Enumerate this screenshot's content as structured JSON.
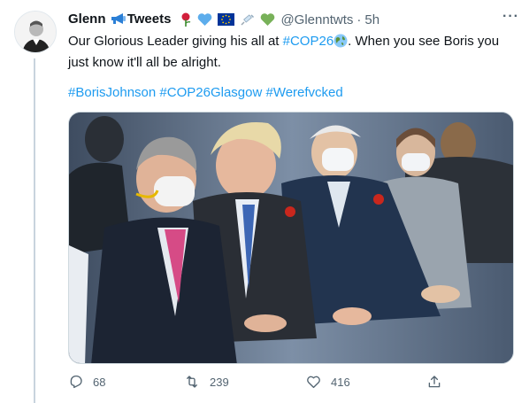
{
  "tweet": {
    "display_name": "Glenn",
    "display_name_suffix": "Tweets",
    "handle": "@Glenntwts",
    "separator": "·",
    "time": "5h",
    "more_label": "···",
    "text_before": "Our Glorious Leader giving his all at ",
    "cop_tag": "#COP26",
    "text_after": ". When you see Boris you just know it'll all be alright.",
    "hashtags": [
      "#BorisJohnson",
      "#COP26Glasgow",
      "#Werefvcked"
    ],
    "image_alt": "Photo of four men in suits and face masks seated at an event, a woman in a face mask behind them"
  },
  "actions": {
    "reply_count": "68",
    "retweet_count": "239",
    "like_count": "416"
  },
  "icons": {
    "megaphone": "megaphone-icon",
    "rose": "rose-icon",
    "heart_blue": "blue-heart-icon",
    "eu_flag": "eu-flag-icon",
    "syringe": "syringe-icon",
    "heart_green": "green-heart-icon",
    "globe": "globe-icon",
    "reply": "reply-icon",
    "retweet": "retweet-icon",
    "like": "heart-icon",
    "share": "share-icon"
  },
  "colors": {
    "link": "#1d9bf0",
    "muted": "#536471",
    "thread_line": "#c8d4dd"
  }
}
